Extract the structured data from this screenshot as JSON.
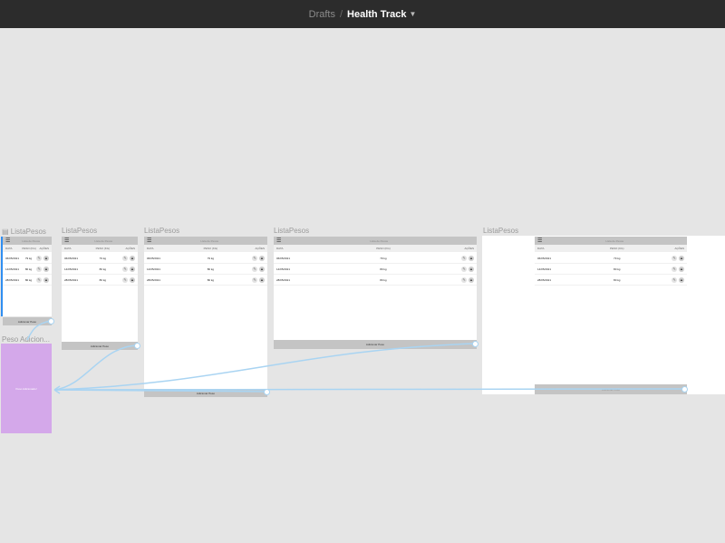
{
  "topbar": {
    "breadcrumb_parent": "Drafts",
    "separator": "/",
    "file_title": "Health Track",
    "dropdown_icon": "chevron-down-icon"
  },
  "frames": [
    {
      "label": "ListaPesos",
      "header_title": "Lista de Pesos",
      "columns": [
        "DATA",
        "PESO (KG)",
        "AÇÕES"
      ],
      "rows": [
        {
          "date": "06/05/2021",
          "weight": "79 kg"
        },
        {
          "date": "14/05/2021",
          "weight": "80 kg"
        },
        {
          "date": "28/05/2021",
          "weight": "80 kg"
        }
      ],
      "add_button": "Adicionar Peso"
    },
    {
      "label": "ListaPesos",
      "header_title": "Lista de Pesos",
      "columns": [
        "DATA",
        "PESO (KG)",
        "AÇÕES"
      ],
      "rows": [
        {
          "date": "06/05/2021",
          "weight": "79 kg"
        },
        {
          "date": "14/05/2021",
          "weight": "80 kg"
        },
        {
          "date": "28/05/2021",
          "weight": "80 kg"
        }
      ],
      "add_button": "Adicionar Peso"
    },
    {
      "label": "ListaPesos",
      "header_title": "Lista de Pesos",
      "columns": [
        "DATA",
        "PESO (KG)",
        "AÇÕES"
      ],
      "rows": [
        {
          "date": "06/05/2021",
          "weight": "79 kg"
        },
        {
          "date": "14/05/2021",
          "weight": "80 kg"
        },
        {
          "date": "28/05/2021",
          "weight": "80 kg"
        }
      ],
      "add_button": "Adicionar Peso"
    },
    {
      "label": "ListaPesos",
      "header_title": "Lista de Pesos",
      "columns": [
        "DATA",
        "PESO (KG)",
        "AÇÕES"
      ],
      "rows": [
        {
          "date": "06/05/2021",
          "weight": "79 kg"
        },
        {
          "date": "14/05/2021",
          "weight": "80 kg"
        },
        {
          "date": "28/05/2021",
          "weight": "80 kg"
        }
      ],
      "add_button": "Adicionar Peso"
    },
    {
      "label": "ListaPesos",
      "header_title": "Lista de Pesos",
      "columns": [
        "DATA",
        "PESO (KG)",
        "AÇÕES"
      ],
      "rows": [
        {
          "date": "06/05/2021",
          "weight": "79 kg"
        },
        {
          "date": "14/05/2021",
          "weight": "80 kg"
        },
        {
          "date": "28/05/2021",
          "weight": "80 kg"
        }
      ],
      "add_button": "Adicionar Peso"
    }
  ],
  "confirm_frame": {
    "label": "Peso Adicion...",
    "message": "Peso Adicionado!"
  },
  "colors": {
    "topbar": "#2c2c2c",
    "canvas": "#e5e5e5",
    "prototype_link": "#a9d4f2",
    "confirm_fill": "#d4a8ea",
    "button_fill": "#c4c4c4"
  }
}
